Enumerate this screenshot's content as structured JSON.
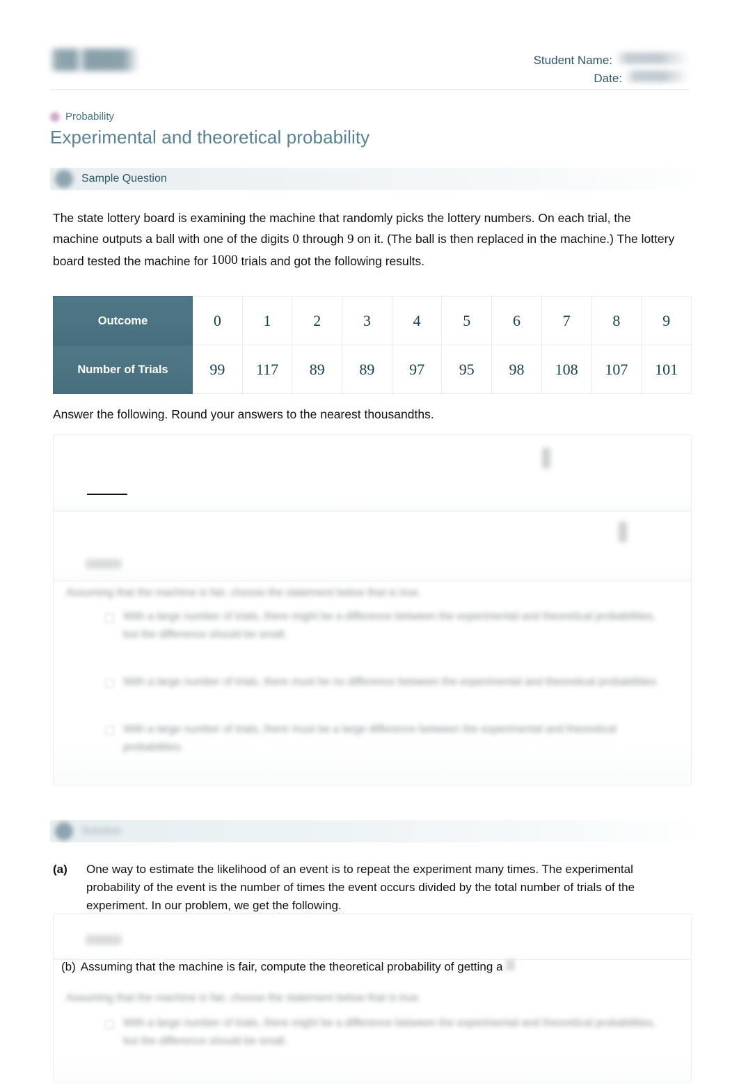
{
  "header": {
    "logo_alt": "aleks-logo",
    "student_name_label": "Student Name:",
    "student_name_value": "",
    "date_label": "Date:",
    "date_value": ""
  },
  "topic": {
    "label": "Probability",
    "dot_color": "#c79cc0"
  },
  "title": "Experimental and theoretical probability",
  "banners": {
    "sample": {
      "label": "Sample Question"
    },
    "solution": {
      "label": "Solution"
    }
  },
  "question": {
    "part1": "The state lottery board is examining the machine that randomly picks the lottery numbers. On each trial, the machine outputs a ball with one of the digits ",
    "digit_low": "0",
    "part2": " through ",
    "digit_high": "9",
    "part3": " on it. (The ball is then replaced in the machine.) The lottery board tested the machine for ",
    "trials": "1000",
    "part4": " trials and got the following results."
  },
  "table": {
    "row_header_outcome": "Outcome",
    "row_header_trials": "Number of Trials",
    "outcomes": [
      "0",
      "1",
      "2",
      "3",
      "4",
      "5",
      "6",
      "7",
      "8",
      "9"
    ],
    "trials": [
      "99",
      "117",
      "89",
      "89",
      "97",
      "95",
      "98",
      "108",
      "107",
      "101"
    ],
    "header_bg": "#4b7382",
    "cell_text_color": "#17404f"
  },
  "instruction": "Answer the following. Round your answers to the nearest thousandths.",
  "redacted": {
    "note": "content is blurred / illegible in the source screenshot",
    "option_line": "Assuming that the machine is fair, choose the statement below that is true.",
    "options": [
      "With a large number of trials, there might be a difference between the experimental and theoretical probabilities, but the difference should be small.",
      "With a large number of trials, there must be no difference between the experimental and theoretical probabilities.",
      "With a large number of trials, there must be a large difference between the experimental and theoretical probabilities."
    ]
  },
  "solution": {
    "a": {
      "tag": "(a)",
      "text": "One way to estimate the likelihood of an event is to repeat the experiment many times. The experimental probability of the event is the number of times the event occurs divided by the total number of trials of the experiment. In our problem, we get the following."
    },
    "b": {
      "tag": "(b)",
      "text": "Assuming that the machine is fair, compute the theoretical probability of getting a"
    }
  }
}
